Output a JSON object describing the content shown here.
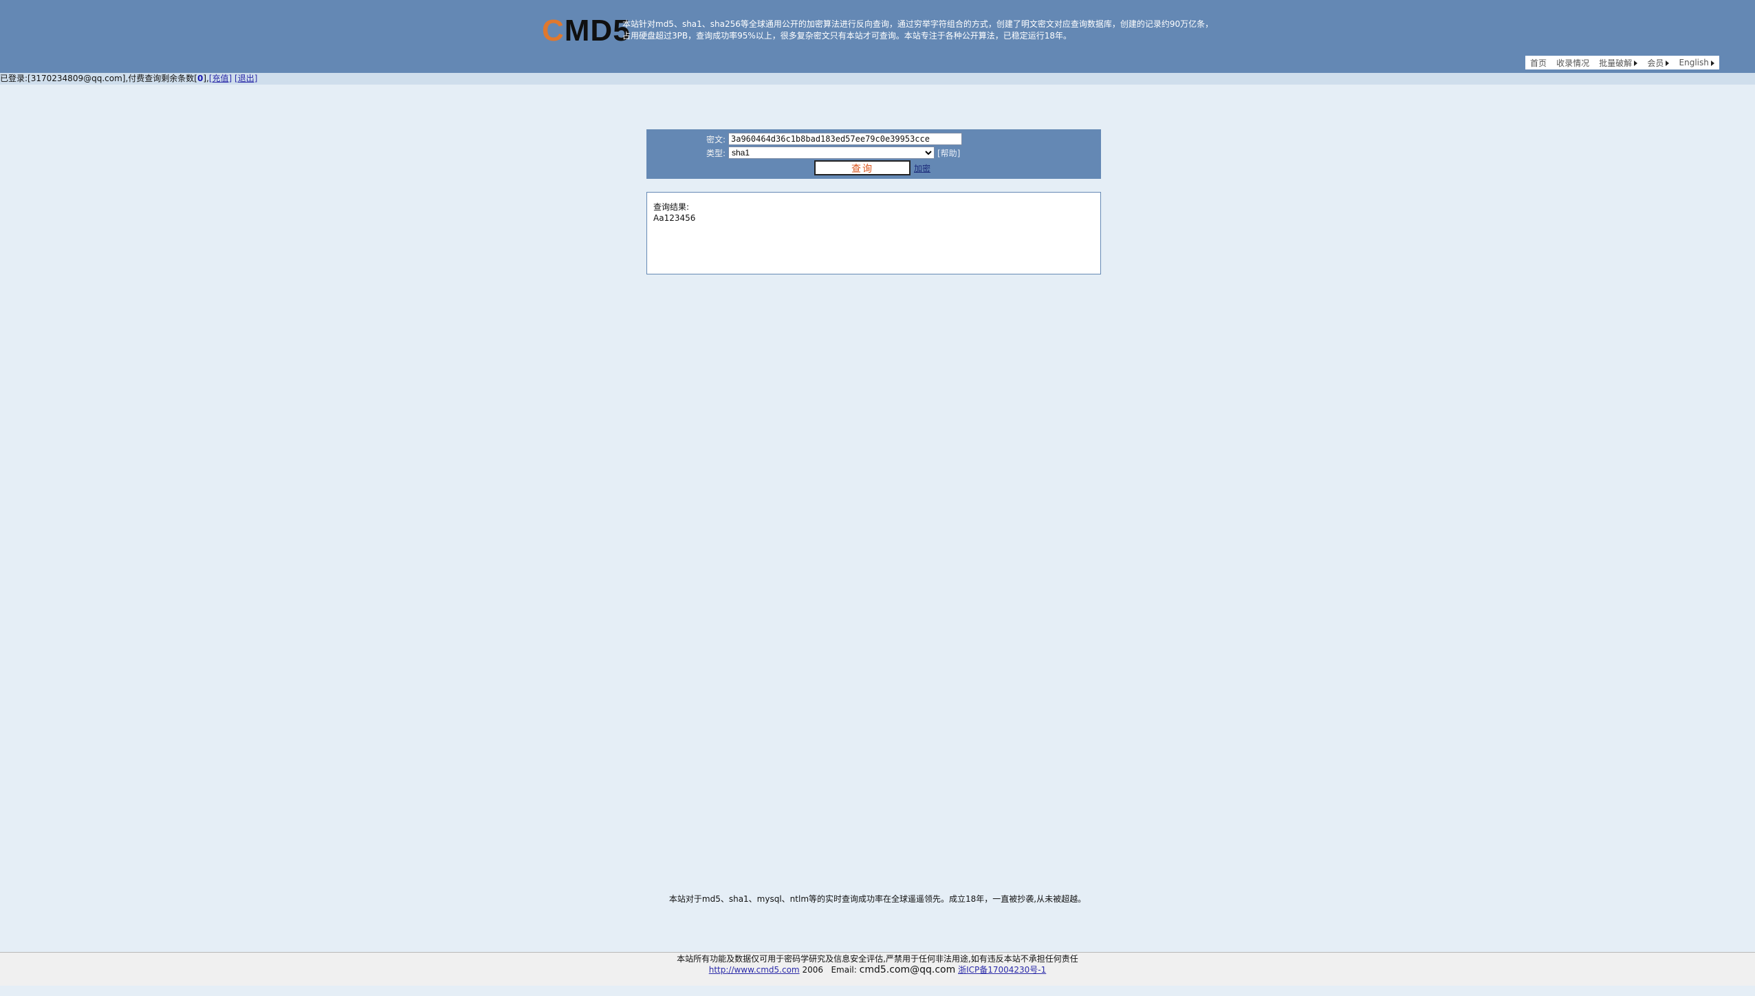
{
  "header": {
    "logo_c": "C",
    "logo_rest": "MD5",
    "intro_line1": "本站针对md5、sha1、sha256等全球通用公开的加密算法进行反向查询，通过穷举字符组合的方式，创建了明文密文对应查询数据库，创建的记录约90万亿条，",
    "intro_line2": "占用硬盘超过3PB，查询成功率95%以上，很多复杂密文只有本站才可查询。本站专注于各种公开算法，已稳定运行18年。",
    "nav": {
      "home": "首页",
      "collection": "收录情况",
      "batch": "批量破解",
      "member": "会员",
      "english": "English"
    }
  },
  "login": {
    "prefix": "已登录:[",
    "email": "3170234809@qq.com",
    "middle": "],付费查询剩余条数[",
    "count": "0",
    "suffix": "],",
    "recharge": "[充值]",
    "logout": "[退出]"
  },
  "query": {
    "cipher_label": "密文:",
    "cipher_value": "3a960464d36c1b8bad183ed57ee79c0e39953cce",
    "type_label": "类型:",
    "type_value": "sha1",
    "help": "[帮助]",
    "query_button": "查询",
    "encrypt_link": "加密"
  },
  "result": {
    "label": "查询结果:",
    "value": "Aa123456"
  },
  "note": "本站对于md5、sha1、mysql、ntlm等的实时查询成功率在全球遥遥领先。成立18年，一直被抄袭,从未被超越。",
  "footer": {
    "disclaimer": "本站所有功能及数据仅可用于密码学研究及信息安全评估,严禁用于任何非法用途,如有违反本站不承担任何责任",
    "site_link": "http://www.cmd5.com",
    "year": "2006",
    "email_label": "Email:",
    "email_value": "cmd5.com@qq.com",
    "icp": "浙ICP备17004230号-1"
  }
}
